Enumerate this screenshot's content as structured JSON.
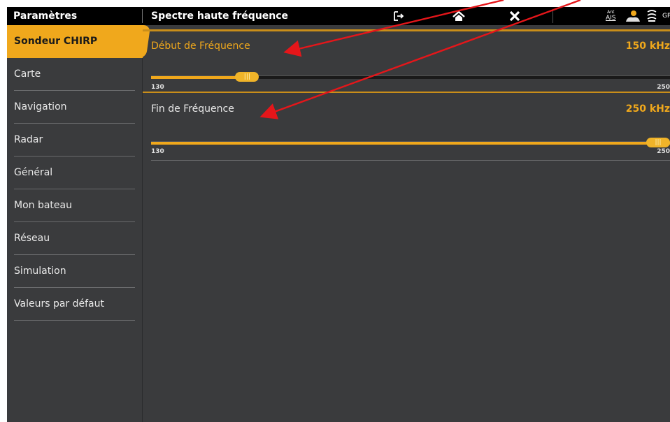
{
  "topbar": {
    "title": "Paramètres",
    "subtitle": "Spectre haute fréquence",
    "exit_glyph": "[→",
    "home_glyph": "⌂",
    "close_glyph": "✕",
    "status_ais_top": "Ant",
    "status_ais": "AIS",
    "status_gps": "GP"
  },
  "sidebar": {
    "items": [
      {
        "label": "Sondeur CHIRP"
      },
      {
        "label": "Carte"
      },
      {
        "label": "Navigation"
      },
      {
        "label": "Radar"
      },
      {
        "label": "Général"
      },
      {
        "label": "Mon bateau"
      },
      {
        "label": "Réseau"
      },
      {
        "label": "Simulation"
      },
      {
        "label": "Valeurs par défaut"
      }
    ]
  },
  "settings": {
    "start": {
      "label": "Début de Fréquence",
      "value": "150 kHz",
      "min": "130",
      "max": "250",
      "level_fraction": 0.17
    },
    "end": {
      "label": "Fin de Fréquence",
      "value": "250 kHz",
      "min": "130",
      "max": "250",
      "level_fraction": 1.0
    }
  },
  "colors": {
    "accent": "#f0a81c",
    "background": "#3a3b3d",
    "annotation": "#e5161a"
  },
  "icons": [
    "exit-icon",
    "home-icon",
    "close-icon",
    "ais-icon",
    "person-icon",
    "sonar-icon",
    "gps-icon"
  ]
}
